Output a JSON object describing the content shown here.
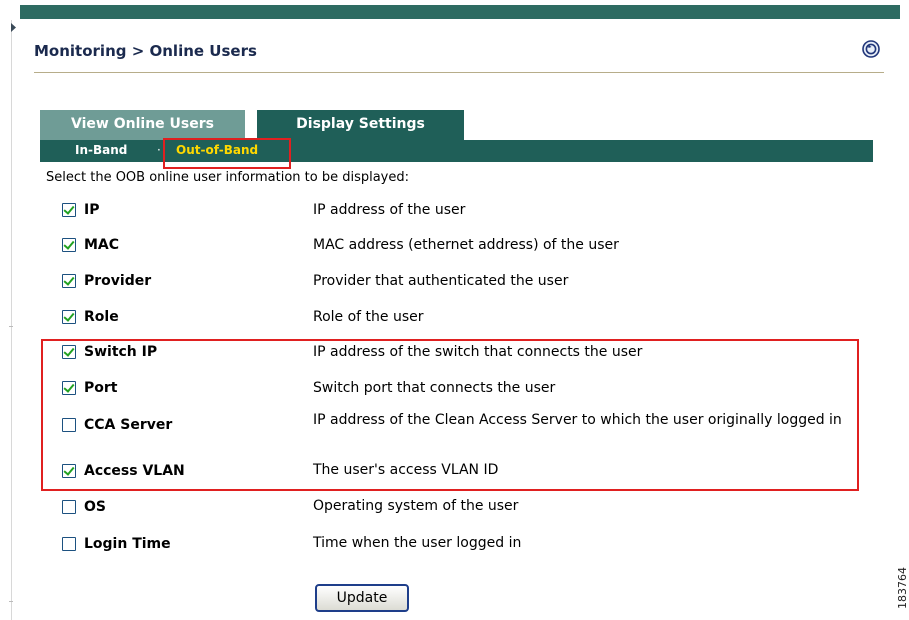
{
  "breadcrumb": "Monitoring > Online Users",
  "tabs": [
    {
      "label": "View Online Users"
    },
    {
      "label": "Display Settings"
    }
  ],
  "subtabs": {
    "in_band": "In-Band",
    "separator": "·",
    "out_of_band": "Out-of-Band"
  },
  "instructions": "Select the OOB online user information to be displayed:",
  "fields": [
    {
      "label": "IP",
      "description": "IP address of the user",
      "checked": true
    },
    {
      "label": "MAC",
      "description": "MAC address (ethernet address) of the user",
      "checked": true
    },
    {
      "label": "Provider",
      "description": "Provider that authenticated the user",
      "checked": true
    },
    {
      "label": "Role",
      "description": "Role of the user",
      "checked": true
    },
    {
      "label": "Switch IP",
      "description": "IP address of the switch that connects the user",
      "checked": true
    },
    {
      "label": "Port",
      "description": "Switch port that connects the user",
      "checked": true
    },
    {
      "label": "CCA Server",
      "description": "IP address of the Clean Access Server to which the user originally logged in",
      "checked": false
    },
    {
      "label": "Access VLAN",
      "description": "The user's access VLAN ID",
      "checked": true
    },
    {
      "label": "OS",
      "description": "Operating system of the user",
      "checked": false
    },
    {
      "label": "Login Time",
      "description": "Time when the user logged in",
      "checked": false
    }
  ],
  "update_label": "Update",
  "figure_number": "183764",
  "colors": {
    "header_bar": "#2e6b62",
    "active_tab": "#1f5f58",
    "inactive_tab": "#6f9c96",
    "selected_subtab": "#ffd800",
    "callout": "#e02020"
  }
}
